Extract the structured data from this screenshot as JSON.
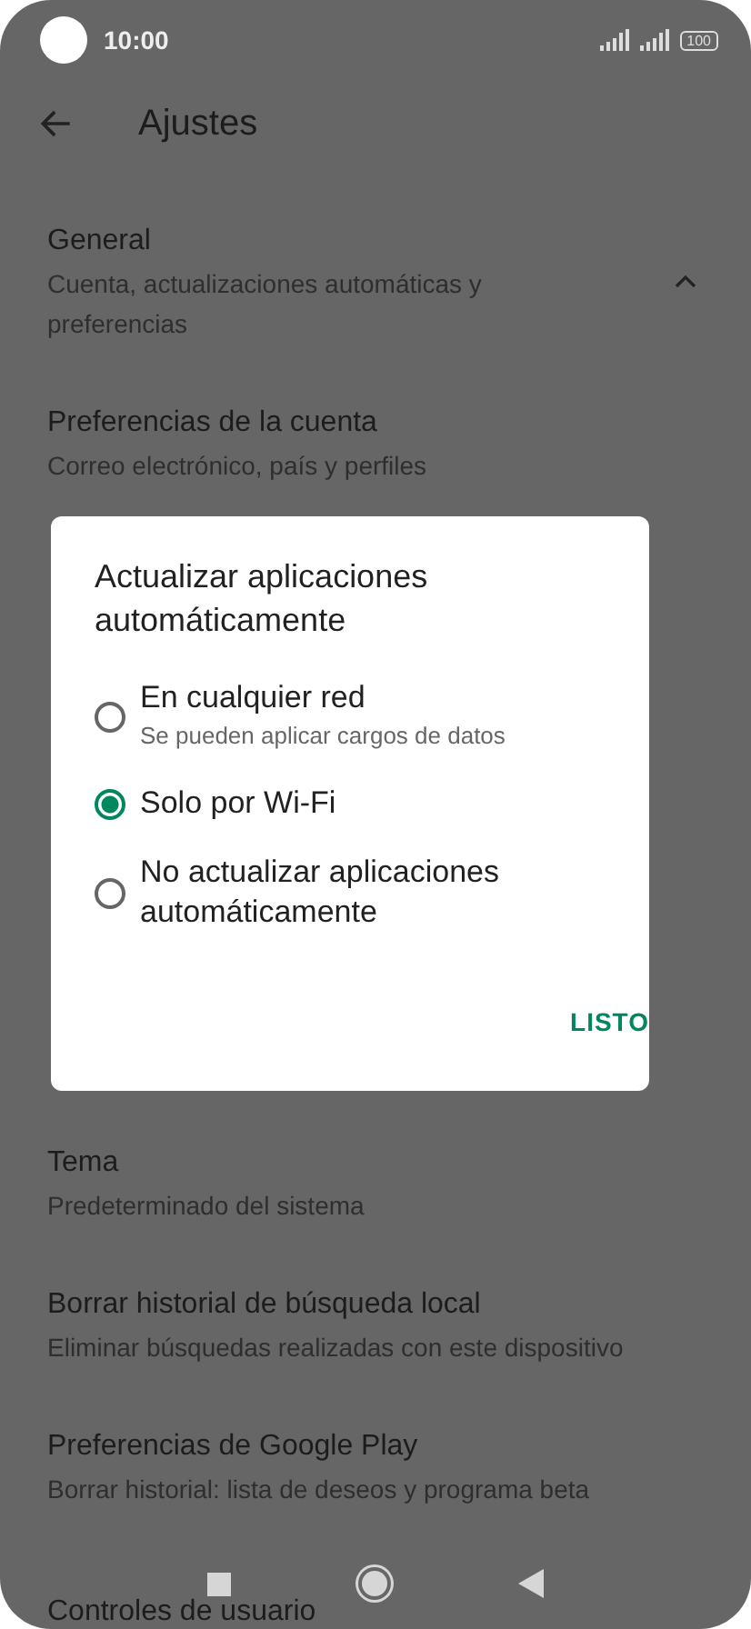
{
  "status_bar": {
    "time": "10:00",
    "battery": "100"
  },
  "app_bar": {
    "title": "Ajustes"
  },
  "settings": [
    {
      "title": "General",
      "subtitle": "Cuenta, actualizaciones automáticas y preferencias",
      "expanded": true
    },
    {
      "title": "Preferencias de la cuenta",
      "subtitle": "Correo electrónico, país y perfiles"
    },
    {
      "title": "Tema",
      "subtitle": "Predeterminado del sistema"
    },
    {
      "title": "Borrar historial de búsqueda local",
      "subtitle": "Eliminar búsquedas realizadas con este dispositivo"
    },
    {
      "title": "Preferencias de Google Play",
      "subtitle": "Borrar historial: lista de deseos y programa beta"
    },
    {
      "title": "Controles de usuario"
    }
  ],
  "dialog": {
    "title": "Actualizar aplicaciones automáticamente",
    "options": [
      {
        "label": "En cualquier red",
        "hint": "Se pueden aplicar cargos de datos",
        "selected": false
      },
      {
        "label": "Solo por Wi-Fi",
        "selected": true
      },
      {
        "label": "No actualizar aplicaciones automáticamente",
        "selected": false
      }
    ],
    "button": "LISTO"
  }
}
